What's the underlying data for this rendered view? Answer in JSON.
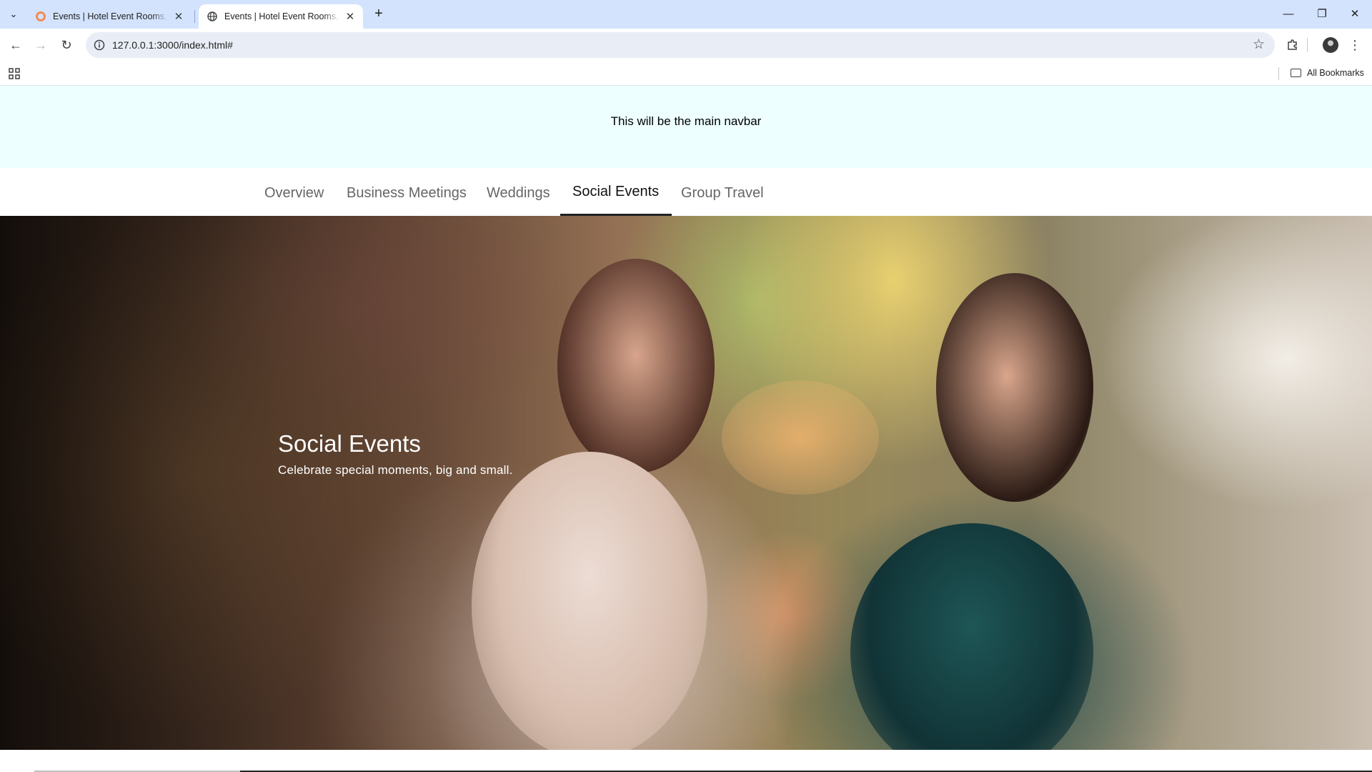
{
  "browser": {
    "tabs": [
      {
        "title": "Events | Hotel Event Rooms, Ha",
        "active": false
      },
      {
        "title": "Events | Hotel Event Rooms, Ha",
        "active": true
      }
    ],
    "url": "127.0.0.1:3000/index.html#",
    "bookmarks_label": "All Bookmarks",
    "icons": {
      "tab_search": "chevron-down-icon",
      "new_tab": "plus-icon",
      "back": "arrow-left-icon",
      "forward": "arrow-right-icon",
      "reload": "reload-icon",
      "site_info": "info-icon",
      "bookmark": "star-icon",
      "extensions": "puzzle-icon",
      "menu": "kebab-menu-icon"
    }
  },
  "navbar": {
    "text": "This will be the main navbar"
  },
  "subnav": {
    "items": [
      {
        "label": "Overview",
        "active": false
      },
      {
        "label": "Business Meetings",
        "active": false
      },
      {
        "label": "Weddings",
        "active": false
      },
      {
        "label": "Social Events",
        "active": true
      },
      {
        "label": "Group Travel",
        "active": false
      }
    ]
  },
  "hero": {
    "title": "Social Events",
    "subtitle": "Celebrate special moments, big and small."
  },
  "colors": {
    "navbar_bg": "#eeffff",
    "active_tab_underline": "#222222",
    "chrome_tabstrip": "#d3e3fd"
  }
}
